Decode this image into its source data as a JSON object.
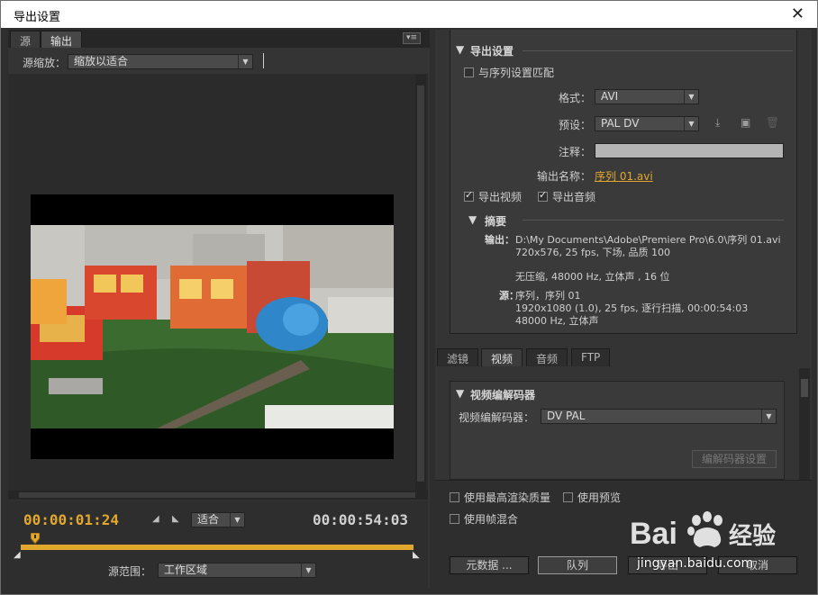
{
  "window": {
    "title": "导出设置",
    "close_glyph": "✕"
  },
  "left": {
    "tabs": [
      {
        "label": "源"
      },
      {
        "label": "输出"
      }
    ],
    "source_scale_label": "源缩放：",
    "source_scale_value": "缩放以适合",
    "timecode_current": "00:00:01:24",
    "timecode_total": "00:00:54:03",
    "fit_value": "适合",
    "source_range_label": "源范围：",
    "source_range_value": "工作区域"
  },
  "export_settings": {
    "heading": "导出设置",
    "match_sequence_label": "与序列设置匹配",
    "match_sequence_checked": false,
    "format_label": "格式：",
    "format_value": "AVI",
    "preset_label": "预设：",
    "preset_value": "PAL DV",
    "comments_label": "注释：",
    "comments_value": "",
    "output_name_label": "输出名称：",
    "output_name_value": "序列 01.avi",
    "export_video_label": "导出视频",
    "export_video_checked": true,
    "export_audio_label": "导出音频",
    "export_audio_checked": true
  },
  "summary": {
    "heading": "摘要",
    "output_key": "输出：",
    "output_lines": [
      "D:\\My Documents\\Adobe\\Premiere Pro\\6.0\\序列 01.avi",
      "720x576, 25 fps, 下场, 品质 100",
      "无压缩, 48000 Hz, 立体声 , 16 位"
    ],
    "source_key": "源：",
    "source_lines": [
      "序列，序列 01",
      "1920x1080 (1.0), 25 fps, 逐行扫描, 00:00:54:03",
      "48000 Hz, 立体声"
    ]
  },
  "right_tabs": [
    {
      "label": "滤镜"
    },
    {
      "label": "视频"
    },
    {
      "label": "音频"
    },
    {
      "label": "FTP"
    }
  ],
  "video_codec": {
    "heading": "视频编解码器",
    "codec_label": "视频编解码器：",
    "codec_value": "DV PAL",
    "codec_settings_button": "编解码器设置"
  },
  "options": {
    "max_render_quality_label": "使用最高渲染质量",
    "use_previews_label": "使用预览",
    "frame_blending_label": "使用帧混合"
  },
  "buttons": {
    "metadata": "元数据 ...",
    "queue": "队列",
    "export": "导出",
    "cancel": "取消"
  },
  "watermark": {
    "text": "jingyan.baidu.com",
    "brand": "Bai du 经验"
  }
}
